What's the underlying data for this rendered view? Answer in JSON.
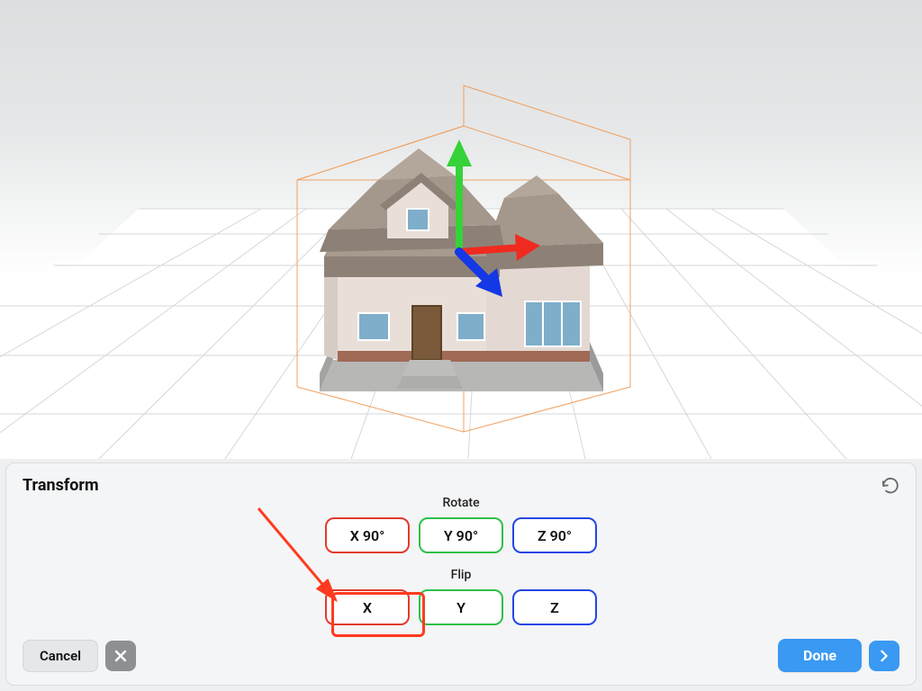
{
  "panel": {
    "title": "Transform",
    "sections": {
      "rotate": {
        "label": "Rotate",
        "x": "X  90°",
        "y": "Y  90°",
        "z": "Z  90°"
      },
      "flip": {
        "label": "Flip",
        "x": "X",
        "y": "Y",
        "z": "Z"
      }
    },
    "footer": {
      "cancel": "Cancel",
      "done": "Done"
    }
  },
  "colors": {
    "x_axis": "#e23a2e",
    "y_axis": "#2fbf4a",
    "z_axis": "#2546e6",
    "highlight": "#ff3b1f",
    "primary": "#3a99f2"
  },
  "highlight_target": "flip-x-button"
}
